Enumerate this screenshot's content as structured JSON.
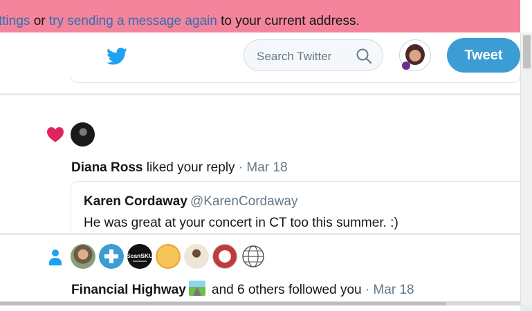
{
  "banner": {
    "link1": "ttings",
    "or": " or ",
    "link2": "try sending a message again",
    "rest": " to your current address."
  },
  "header": {
    "search_placeholder": "Search Twitter",
    "tweet_label": "Tweet"
  },
  "notifications": [
    {
      "type": "like",
      "actor": "Diana Ross",
      "action": " liked your reply",
      "date": " · Mar 18",
      "quoted": {
        "name": "Karen Cordaway",
        "handle": "@KarenCordaway",
        "text": "He was great at your concert in CT too this summer. :)"
      }
    },
    {
      "type": "follow",
      "actor": "Financial Highway",
      "action": " and 6 others followed you",
      "date": " · Mar 18",
      "avatars": [
        "man-avatar",
        "plus-logo-avatar",
        "scansku-avatar",
        "yellow-logo-avatar",
        "person-avatar",
        "santa-avatar",
        "globe-sketch-avatar"
      ],
      "avatar_texts": {
        "scansku": "ScanSKU"
      }
    }
  ],
  "colors": {
    "brand": "#1da1f2",
    "banner_bg": "#f4849b",
    "like": "#e0245e",
    "follow": "#1da1f2"
  }
}
